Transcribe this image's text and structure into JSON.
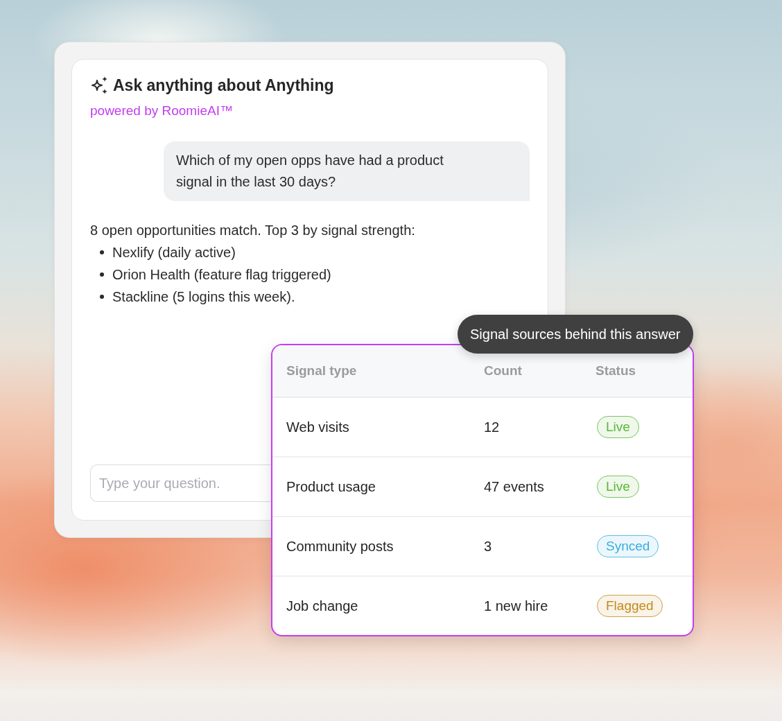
{
  "chat": {
    "title": "Ask anything about Anything",
    "subtitle": "powered by RoomieAI™",
    "messages": [
      {
        "kind": "user",
        "text": "Which of my open opps have had a product signal in the last 30 days?"
      },
      {
        "kind": "assistant",
        "text": "8 open opportunities match. Top 3 by signal strength:",
        "bullets": [
          "Nexlify (daily active)",
          "Orion Health (feature flag triggered)",
          "Stackline (5 logins this week)."
        ]
      }
    ],
    "input": {
      "placeholder": "Type your question."
    }
  },
  "tooltip": {
    "text": "Signal sources behind this answer"
  },
  "table": {
    "columns": [
      "Signal type",
      "Count",
      "Status"
    ],
    "rows": [
      {
        "signal_type": "Web visits",
        "count": "12",
        "status": {
          "label": "Live",
          "color": "#5ab836"
        }
      },
      {
        "signal_type": "Product usage",
        "count": "47 events",
        "status": {
          "label": "Live",
          "color": "#5ab836"
        }
      },
      {
        "signal_type": "Community posts",
        "count": "3",
        "status": {
          "label": "Synced",
          "color": "#38ade0"
        }
      },
      {
        "signal_type": "Job change",
        "count": "1 new hire",
        "status": {
          "label": "Flagged",
          "color": "#c48a1c"
        }
      }
    ]
  }
}
